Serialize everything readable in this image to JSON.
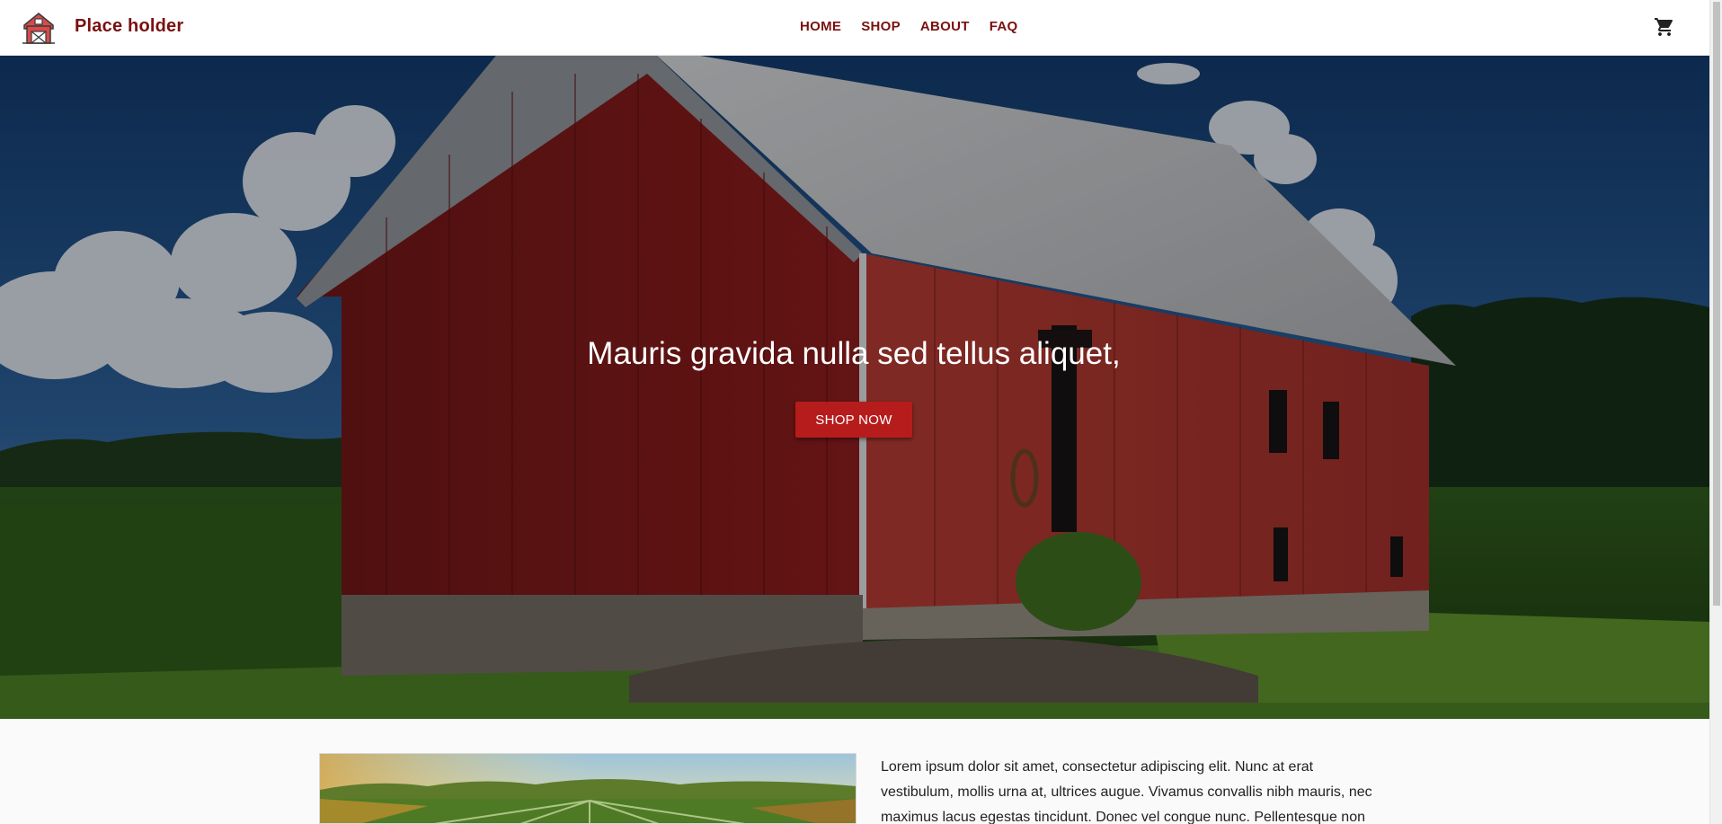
{
  "header": {
    "brand": "Place holder",
    "logo_icon": "barn-icon",
    "cart_icon": "cart-icon",
    "nav": [
      {
        "label": "HOME"
      },
      {
        "label": "SHOP"
      },
      {
        "label": "ABOUT"
      },
      {
        "label": "FAQ"
      }
    ]
  },
  "hero": {
    "title": "Mauris gravida nulla sed tellus aliquet,",
    "button_label": "SHOP NOW"
  },
  "intro": {
    "text": "Lorem ipsum dolor sit amet, consectetur adipiscing elit. Nunc at erat vestibulum, mollis urna at, ultrices augue. Vivamus convallis nibh mauris, nec maximus lacus egestas tincidunt. Donec vel congue nunc. Pellentesque non"
  },
  "colors": {
    "brand": "#7a1010",
    "button": "#b71c1c",
    "barn_red": "#a8302a"
  }
}
